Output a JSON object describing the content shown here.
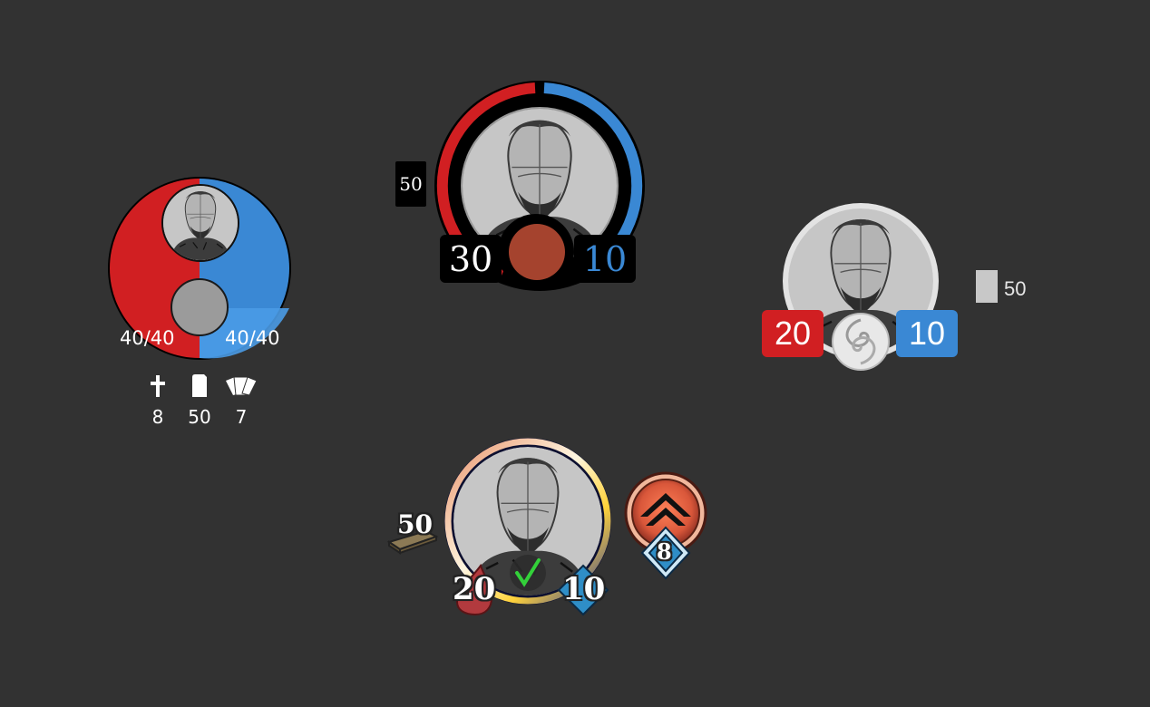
{
  "colors": {
    "background": "#323232",
    "red": "#d11f22",
    "blue": "#3a88d4",
    "black": "#000000",
    "rust": "#a5432e"
  },
  "widget_a": {
    "health": "40/40",
    "shield": "40/40",
    "stats": [
      {
        "icon": "cross-icon",
        "value": "8"
      },
      {
        "icon": "card-icon",
        "value": "50"
      },
      {
        "icon": "hand-of-cards-icon",
        "value": "7"
      }
    ]
  },
  "widget_b": {
    "deck_count": "50",
    "health": "30",
    "shield": "10"
  },
  "widget_c": {
    "health": "20",
    "shield": "10",
    "deck_count": "50"
  },
  "widget_d": {
    "deck_count": "50",
    "health": "20",
    "shield": "10",
    "level": "8"
  }
}
